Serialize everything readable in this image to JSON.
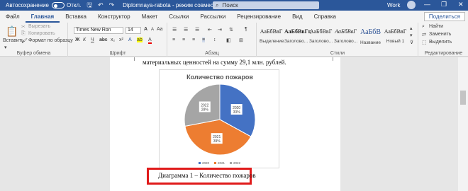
{
  "titlebar": {
    "autosave_label": "Автосохранение",
    "autosave_state": "Откл.",
    "doc_title": "Diplomnaya-rabota - режим совместимости",
    "search_placeholder": "Поиск",
    "user": "Work",
    "minimize": "—",
    "restore": "❐",
    "close": "✕"
  },
  "tabs": [
    "Файл",
    "Главная",
    "Вставка",
    "Конструктор",
    "Макет",
    "Ссылки",
    "Рассылки",
    "Рецензирование",
    "Вид",
    "Справка"
  ],
  "share_label": "Поделиться",
  "ribbon": {
    "clipboard": {
      "paste": "Вставить",
      "cut": "Вырезать",
      "copy": "Копировать",
      "format_painter": "Формат по образцу",
      "label": "Буфер обмена"
    },
    "font": {
      "family": "Times New Ron",
      "size": "14",
      "label": "Шрифт",
      "bold": "Ж",
      "italic": "К",
      "underline": "Ч",
      "strike": "abc",
      "sub": "x₂",
      "sup": "x²",
      "grow": "A",
      "shrink": "A",
      "case": "Aa",
      "clear": "A",
      "effects": "A",
      "highlight": "ab",
      "color": "A"
    },
    "paragraph": {
      "label": "Абзац"
    },
    "styles": {
      "label": "Стили",
      "items": [
        {
          "sample": "АаБбВвГ",
          "name": "Выделение"
        },
        {
          "sample": "АаБбВвГг,",
          "name": "Заголово..."
        },
        {
          "sample": "АаБбВвГ",
          "name": "Заголово..."
        },
        {
          "sample": "АаБбВвГ",
          "name": "Заголово..."
        },
        {
          "sample": "АаБбВ",
          "name": "Название"
        },
        {
          "sample": "АаБбВвГ",
          "name": "Новый 1"
        }
      ]
    },
    "editing": {
      "label": "Редактирование",
      "find": "Найти",
      "replace": "Заменить",
      "select": "Выделить"
    }
  },
  "document": {
    "body_line": "материальных ценностей на сумму 29,1 млн. рублей.",
    "caption": "Диаграмма 1 – Количество пожаров"
  },
  "chart_data": {
    "type": "pie",
    "title": "Количество пожаров",
    "categories": [
      "2020",
      "2021",
      "2022"
    ],
    "values": [
      33,
      39,
      28
    ],
    "labels": [
      {
        "year": "2020",
        "pct": "33%"
      },
      {
        "year": "2021",
        "pct": "39%"
      },
      {
        "year": "2022",
        "pct": "28%"
      }
    ],
    "colors": [
      "#4472c4",
      "#ed7d31",
      "#a5a5a5"
    ],
    "legend": "bottom"
  }
}
